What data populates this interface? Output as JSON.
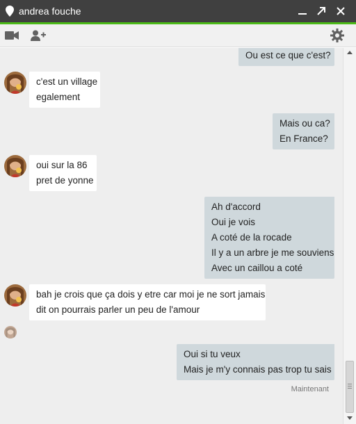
{
  "window": {
    "title": "andrea fouche",
    "accent_color": "#4cbb17",
    "titlebar_color": "#404040"
  },
  "toolbar": {
    "icons": [
      "video-icon",
      "add-user-icon",
      "gear-icon"
    ]
  },
  "messages": [
    {
      "direction": "out",
      "lines": [
        "Ou est ce que c'est?"
      ]
    },
    {
      "direction": "in",
      "lines": [
        "c'est un village",
        "egalement"
      ]
    },
    {
      "direction": "out",
      "lines": [
        "Mais ou ca?",
        "En France?"
      ]
    },
    {
      "direction": "in",
      "lines": [
        "oui sur la 86",
        "pret de yonne"
      ]
    },
    {
      "direction": "out",
      "lines": [
        "Ah d'accord",
        "Oui je vois",
        "A coté de la rocade",
        "Il y a un arbre je me souviens",
        "Avec un caillou a coté"
      ]
    },
    {
      "direction": "in",
      "lines": [
        "bah je crois que ça dois y etre car moi je ne sort jamais",
        "dit on pourrais parler un peu de l'amour"
      ]
    },
    {
      "direction": "out",
      "lines": [
        "Oui si tu veux",
        "Mais je m'y connais pas trop tu sais"
      ]
    }
  ],
  "timestamp": "Maintenant",
  "colors": {
    "incoming_bubble": "#ffffff",
    "outgoing_bubble": "#cfd8dc",
    "chat_background": "#eeeeee"
  }
}
